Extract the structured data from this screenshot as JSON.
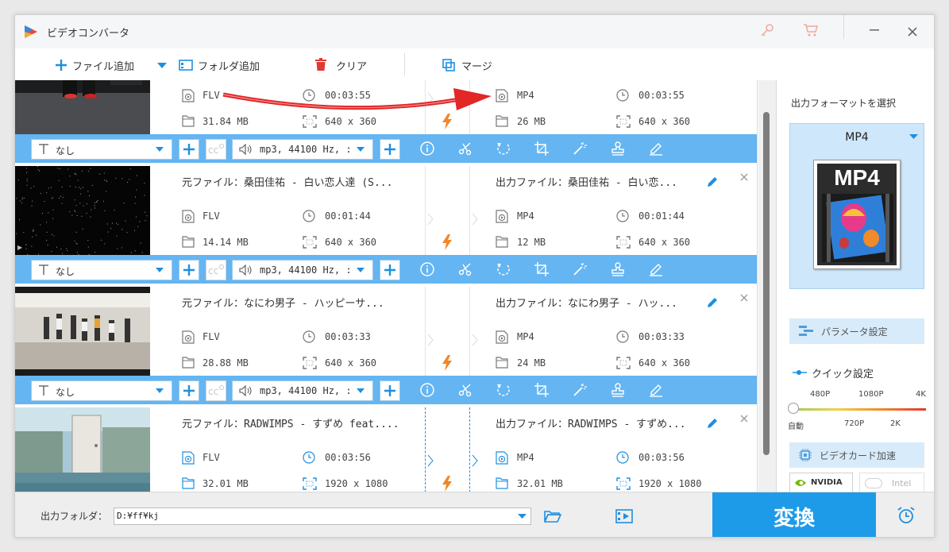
{
  "window": {
    "title": "ビデオコンバータ"
  },
  "toolbar": {
    "add_file": "ファイル追加",
    "add_folder": "フォルダ追加",
    "clear": "クリア",
    "merge": "マージ"
  },
  "labels": {
    "source_prefix": "元ファイル：",
    "output_prefix": "出力ファイル："
  },
  "items": [
    {
      "source_name": "",
      "output_name": "",
      "src_format": "FLV",
      "src_duration": "00:03:55",
      "src_size": "31.84 MB",
      "src_res": "640 x 360",
      "out_format": "MP4",
      "out_duration": "00:03:55",
      "out_size": "26 MB",
      "out_res": "640 x 360",
      "subtitle": "なし",
      "audio": "mp3, 44100 Hz, :"
    },
    {
      "source_name": "桑田佳祐 - 白い恋人達 (S...",
      "output_name": "桑田佳祐 - 白い恋...",
      "src_format": "FLV",
      "src_duration": "00:01:44",
      "src_size": "14.14 MB",
      "src_res": "640 x 360",
      "out_format": "MP4",
      "out_duration": "00:01:44",
      "out_size": "12 MB",
      "out_res": "640 x 360",
      "subtitle": "なし",
      "audio": "mp3, 44100 Hz, :"
    },
    {
      "source_name": "なにわ男子 - ハッピーサ...",
      "output_name": "なにわ男子 - ハッ...",
      "src_format": "FLV",
      "src_duration": "00:03:33",
      "src_size": "28.88 MB",
      "src_res": "640 x 360",
      "out_format": "MP4",
      "out_duration": "00:03:33",
      "out_size": "24 MB",
      "out_res": "640 x 360",
      "subtitle": "なし",
      "audio": "mp3, 44100 Hz, :"
    },
    {
      "source_name": "RADWIMPS - すずめ feat....",
      "output_name": "RADWIMPS - すずめ...",
      "src_format": "FLV",
      "src_duration": "00:03:56",
      "src_size": "32.01 MB",
      "src_res": "1920 x 1080",
      "out_format": "MP4",
      "out_duration": "00:03:56",
      "out_size": "32.01 MB",
      "out_res": "1920 x 1080",
      "subtitle": "",
      "audio": ""
    }
  ],
  "panel": {
    "title": "出力フォーマットを選択",
    "format": "MP4",
    "format_icon_text": "MP4",
    "param_settings": "パラメータ設定",
    "quick_settings": "クイック設定",
    "quality_top": [
      "480P",
      "1080P",
      "4K"
    ],
    "quality_bottom": [
      "自動",
      "720P",
      "2K"
    ],
    "quality_value": 0,
    "gpu_accel": "ビデオカード加速",
    "nvidia": "NVIDIA",
    "intel": "Intel"
  },
  "bottom": {
    "output_folder_label": "出力フォルダ：",
    "output_folder_value": "D:¥ff¥kj",
    "convert": "変換"
  },
  "colors": {
    "accent": "#1e9be8",
    "bar": "#64b5f2",
    "lightning": "#f0872a",
    "arrow": "#e32626"
  },
  "icons": [
    "logo-icon",
    "key-icon",
    "cart-icon",
    "minimize-icon",
    "close-icon",
    "plus-icon",
    "chevron-down-icon",
    "folder-add-icon",
    "trash-icon",
    "merge-icon",
    "video-file-icon",
    "clock-icon",
    "file-icon",
    "resolution-icon",
    "lightning-icon",
    "text-icon",
    "cc-icon",
    "speaker-icon",
    "info-icon",
    "scissors-icon",
    "rotate-icon",
    "crop-icon",
    "magic-wand-icon",
    "watermark-icon",
    "edit-icon",
    "pencil-icon",
    "settings-icon",
    "chip-icon",
    "folder-open-icon",
    "folder-video-icon",
    "alarm-icon"
  ]
}
